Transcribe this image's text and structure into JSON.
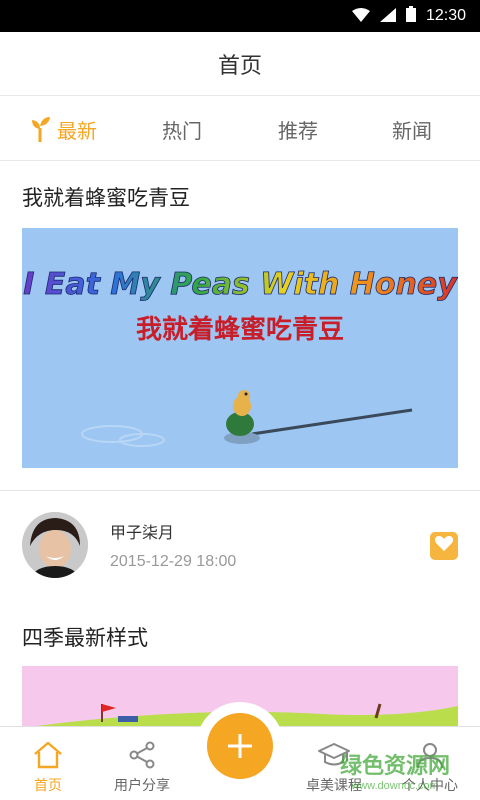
{
  "status_bar": {
    "time": "12:30"
  },
  "header": {
    "title": "首页"
  },
  "tabs": [
    {
      "label": "最新",
      "active": true
    },
    {
      "label": "热门",
      "active": false
    },
    {
      "label": "推荐",
      "active": false
    },
    {
      "label": "新闻",
      "active": false
    }
  ],
  "posts": [
    {
      "title": "我就着蜂蜜吃青豆",
      "thumbnail_text_en": "I Eat My Peas With Honey",
      "thumbnail_text_cn": "我就着蜂蜜吃青豆",
      "author": "甲子柒月",
      "time": "2015-12-29 18:00"
    },
    {
      "title": "四季最新样式"
    }
  ],
  "bottom_nav": [
    {
      "label": "首页",
      "icon": "home-icon",
      "active": true
    },
    {
      "label": "用户分享",
      "icon": "share-icon",
      "active": false
    },
    {
      "label": "卓美课程",
      "icon": "graduation-cap-icon",
      "active": false
    },
    {
      "label": "个人中心",
      "icon": "person-icon",
      "active": false
    }
  ],
  "watermark": {
    "main": "绿色资源网",
    "sub": "www.downcc.com"
  },
  "colors": {
    "accent": "#f5a623",
    "text": "#333333",
    "muted": "#999999"
  }
}
